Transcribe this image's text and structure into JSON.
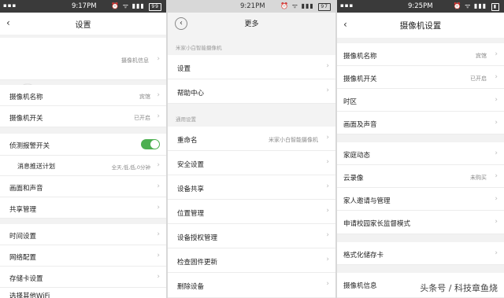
{
  "panel1": {
    "status_time": "9:17PM",
    "status_left": "all",
    "battery": "99",
    "title": "设置",
    "device_info_label": "摄像机信息",
    "rows": [
      {
        "label": "摄像机名称",
        "value": "宾馆"
      },
      {
        "label": "摄像机开关",
        "value": "已开启"
      },
      {
        "label": "侦测报警开关",
        "value": ""
      },
      {
        "label": "消息推送计划",
        "value": "全天,低,低,0分钟"
      },
      {
        "label": "画面和声音",
        "value": ""
      },
      {
        "label": "共享管理",
        "value": ""
      },
      {
        "label": "时间设置",
        "value": ""
      },
      {
        "label": "网络配置",
        "value": ""
      },
      {
        "label": "存储卡设置",
        "value": ""
      },
      {
        "label": "选择其他WiFi",
        "value": ""
      }
    ]
  },
  "panel2": {
    "status_time": "9:21PM",
    "battery": "97",
    "title": "更多",
    "section1": "米家小白智能摄像机",
    "section2": "通用设置",
    "rows": [
      {
        "label": "设置",
        "value": ""
      },
      {
        "label": "帮助中心",
        "value": ""
      },
      {
        "label": "重命名",
        "value": "米家小白智能摄像机"
      },
      {
        "label": "安全设置",
        "value": ""
      },
      {
        "label": "设备共享",
        "value": ""
      },
      {
        "label": "位置管理",
        "value": ""
      },
      {
        "label": "设备授权管理",
        "value": ""
      },
      {
        "label": "检查固件更新",
        "value": ""
      },
      {
        "label": "删除设备",
        "value": ""
      }
    ]
  },
  "panel3": {
    "status_time": "9:25PM",
    "title": "摄像机设置",
    "rows": [
      {
        "label": "摄像机名称",
        "value": "宾馆"
      },
      {
        "label": "摄像机开关",
        "value": "已开启"
      },
      {
        "label": "时区",
        "value": ""
      },
      {
        "label": "画面及声音",
        "value": ""
      },
      {
        "label": "家庭动态",
        "value": ""
      },
      {
        "label": "云录像",
        "value": "未购买"
      },
      {
        "label": "家人邀请与管理",
        "value": ""
      },
      {
        "label": "申请校园家长监督模式",
        "value": ""
      },
      {
        "label": "格式化储存卡",
        "value": ""
      },
      {
        "label": "摄像机信息",
        "value": ""
      }
    ]
  },
  "watermark": "头条号 / 科技章鱼烧",
  "colors": {
    "accent_green": "#4caf50",
    "statusbar": "#3a3a3a"
  }
}
